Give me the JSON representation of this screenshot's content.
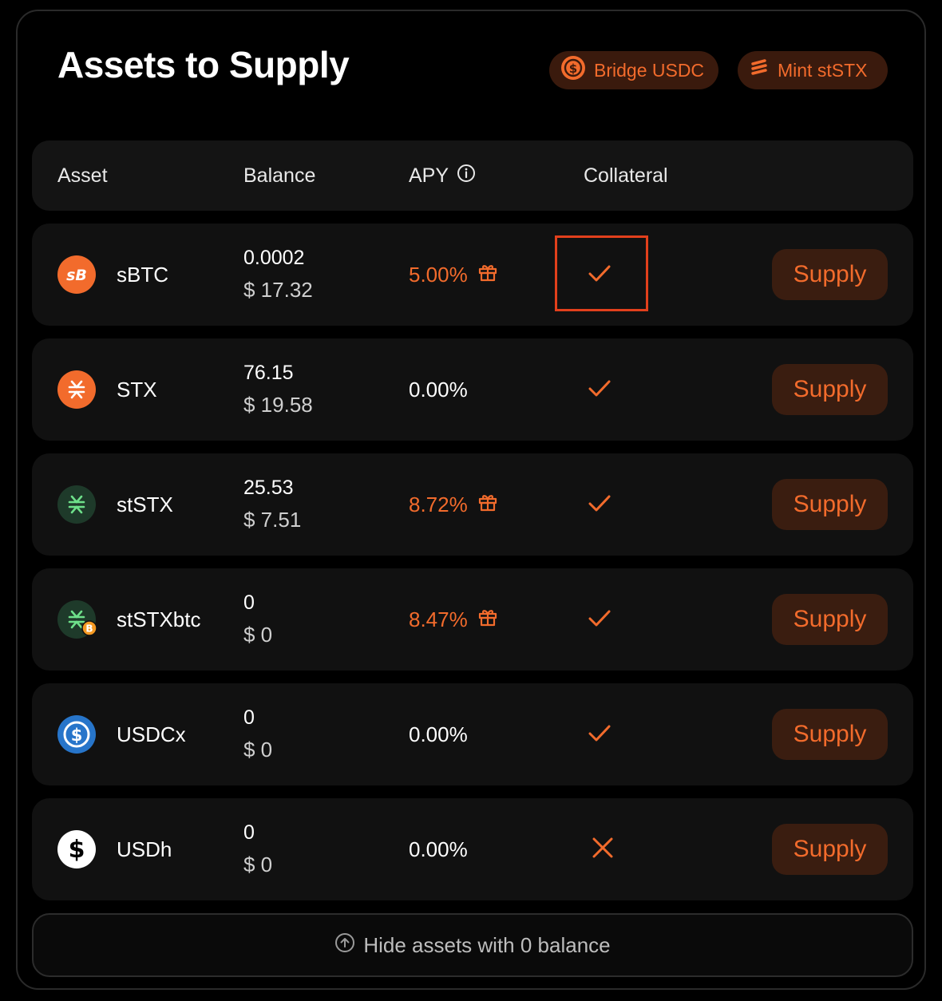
{
  "title": "Assets to Supply",
  "actions": {
    "bridge_label": "Bridge USDC",
    "mint_label": "Mint stSTX"
  },
  "table": {
    "headers": {
      "asset": "Asset",
      "balance": "Balance",
      "apy": "APY",
      "collateral": "Collateral"
    },
    "rows": [
      {
        "asset": "sBTC",
        "balance": "0.0002",
        "usd": "$ 17.32",
        "apy": "5.00%",
        "reward": true,
        "collateral": "check",
        "supply": "Supply",
        "icon": "sbtc-icon"
      },
      {
        "asset": "STX",
        "balance": "76.15",
        "usd": "$ 19.58",
        "apy": "0.00%",
        "reward": false,
        "collateral": "check",
        "supply": "Supply",
        "icon": "stx-icon"
      },
      {
        "asset": "stSTX",
        "balance": "25.53",
        "usd": "$ 7.51",
        "apy": "8.72%",
        "reward": true,
        "collateral": "check",
        "supply": "Supply",
        "icon": "ststx-icon"
      },
      {
        "asset": "stSTXbtc",
        "balance": "0",
        "usd": "$ 0",
        "apy": "8.47%",
        "reward": true,
        "collateral": "check",
        "supply": "Supply",
        "icon": "ststxbtc-icon"
      },
      {
        "asset": "USDCx",
        "balance": "0",
        "usd": "$ 0",
        "apy": "0.00%",
        "reward": false,
        "collateral": "check",
        "supply": "Supply",
        "icon": "usdcx-icon"
      },
      {
        "asset": "USDh",
        "balance": "0",
        "usd": "$ 0",
        "apy": "0.00%",
        "reward": false,
        "collateral": "cross",
        "supply": "Supply",
        "icon": "usdh-icon"
      }
    ]
  },
  "footer": {
    "hide_label": "Hide assets with 0 balance"
  },
  "colors": {
    "accent": "#f26b2c",
    "highlight": "#e2401c",
    "background": "#000000",
    "row": "#111111"
  }
}
